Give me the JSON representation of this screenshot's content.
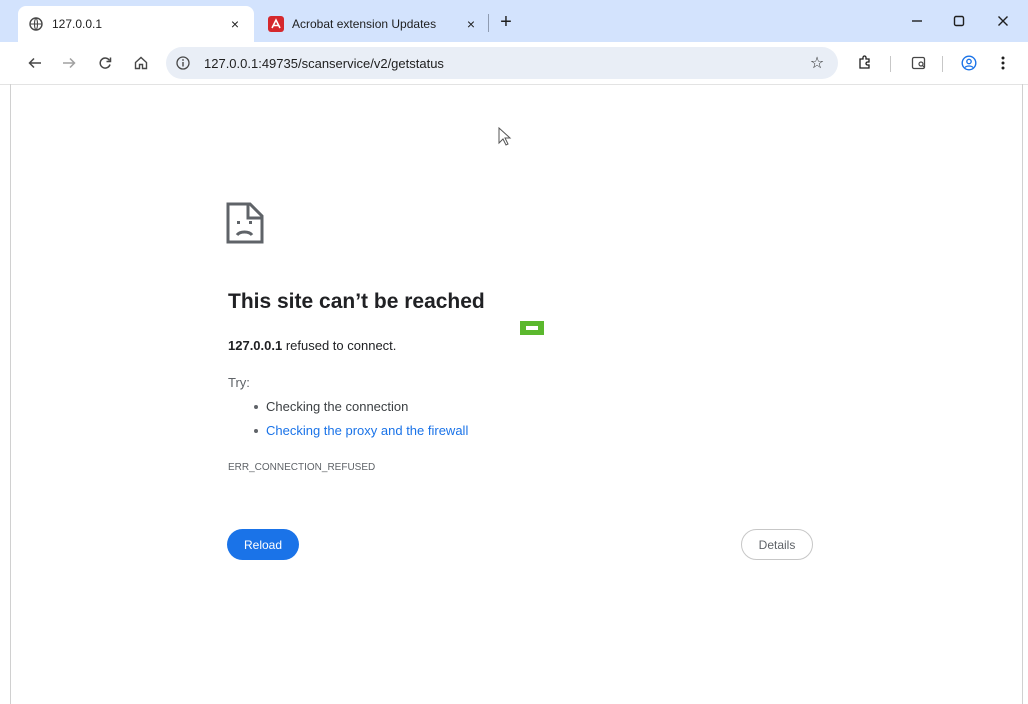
{
  "browser": {
    "tabs": [
      {
        "title": "127.0.0.1",
        "favicon": "globe-icon",
        "active": true
      },
      {
        "title": "Acrobat extension Updates",
        "favicon": "acrobat-icon",
        "active": false
      }
    ],
    "new_tab_symbol": "+",
    "close_symbol": "×",
    "window_controls": {
      "minimize": "–",
      "maximize": "☐",
      "close": "✕"
    },
    "address_bar": {
      "url": "127.0.0.1:49735/scanservice/v2/getstatus"
    },
    "colors": {
      "tabstrip": "#d3e3fd",
      "accent": "#1a73e8",
      "omnibox": "#e9eef6"
    }
  },
  "error_page": {
    "title": "This site can’t be reached",
    "host": "127.0.0.1",
    "message": " refused to connect.",
    "try_label": "Try:",
    "suggestions": [
      {
        "text": "Checking the connection",
        "link": false
      },
      {
        "text": "Checking the proxy and the firewall",
        "link": true
      }
    ],
    "error_code": "ERR_CONNECTION_REFUSED",
    "reload_label": "Reload",
    "details_label": "Details"
  }
}
